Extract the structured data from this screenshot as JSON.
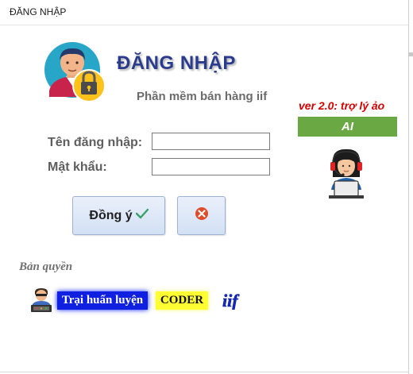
{
  "window": {
    "title": "ĐĂNG NHẬP"
  },
  "header": {
    "heading": "ĐĂNG NHẬP",
    "subtitle": "Phần mềm bán hàng iif"
  },
  "assistant": {
    "version": "ver 2.0: trợ lý ảo",
    "ai_label": "AI"
  },
  "form": {
    "username_label": "Tên đăng nhập:",
    "username_value": "",
    "password_label": "Mật khẩu:",
    "password_value": ""
  },
  "buttons": {
    "ok_label": "Đồng ý"
  },
  "footer": {
    "copyright_label": "Bản quyền",
    "training_badge": "Trại huấn luyện",
    "coder_badge": "CODER",
    "logo_text": "iif"
  },
  "colors": {
    "heading": "#2a3a8c",
    "version": "#d40000",
    "ai_bar": "#6aa844",
    "badge_blue": "#1020e0",
    "badge_yellow": "#ffff33",
    "cancel_icon": "#e04b2a"
  },
  "icons": {
    "user_lock": "user-lock-icon",
    "assistant": "virtual-assistant-icon",
    "ok_check": "checkmark-icon",
    "cancel": "cancel-x-icon",
    "coder": "coder-person-icon",
    "logo": "iif-logo-icon"
  }
}
